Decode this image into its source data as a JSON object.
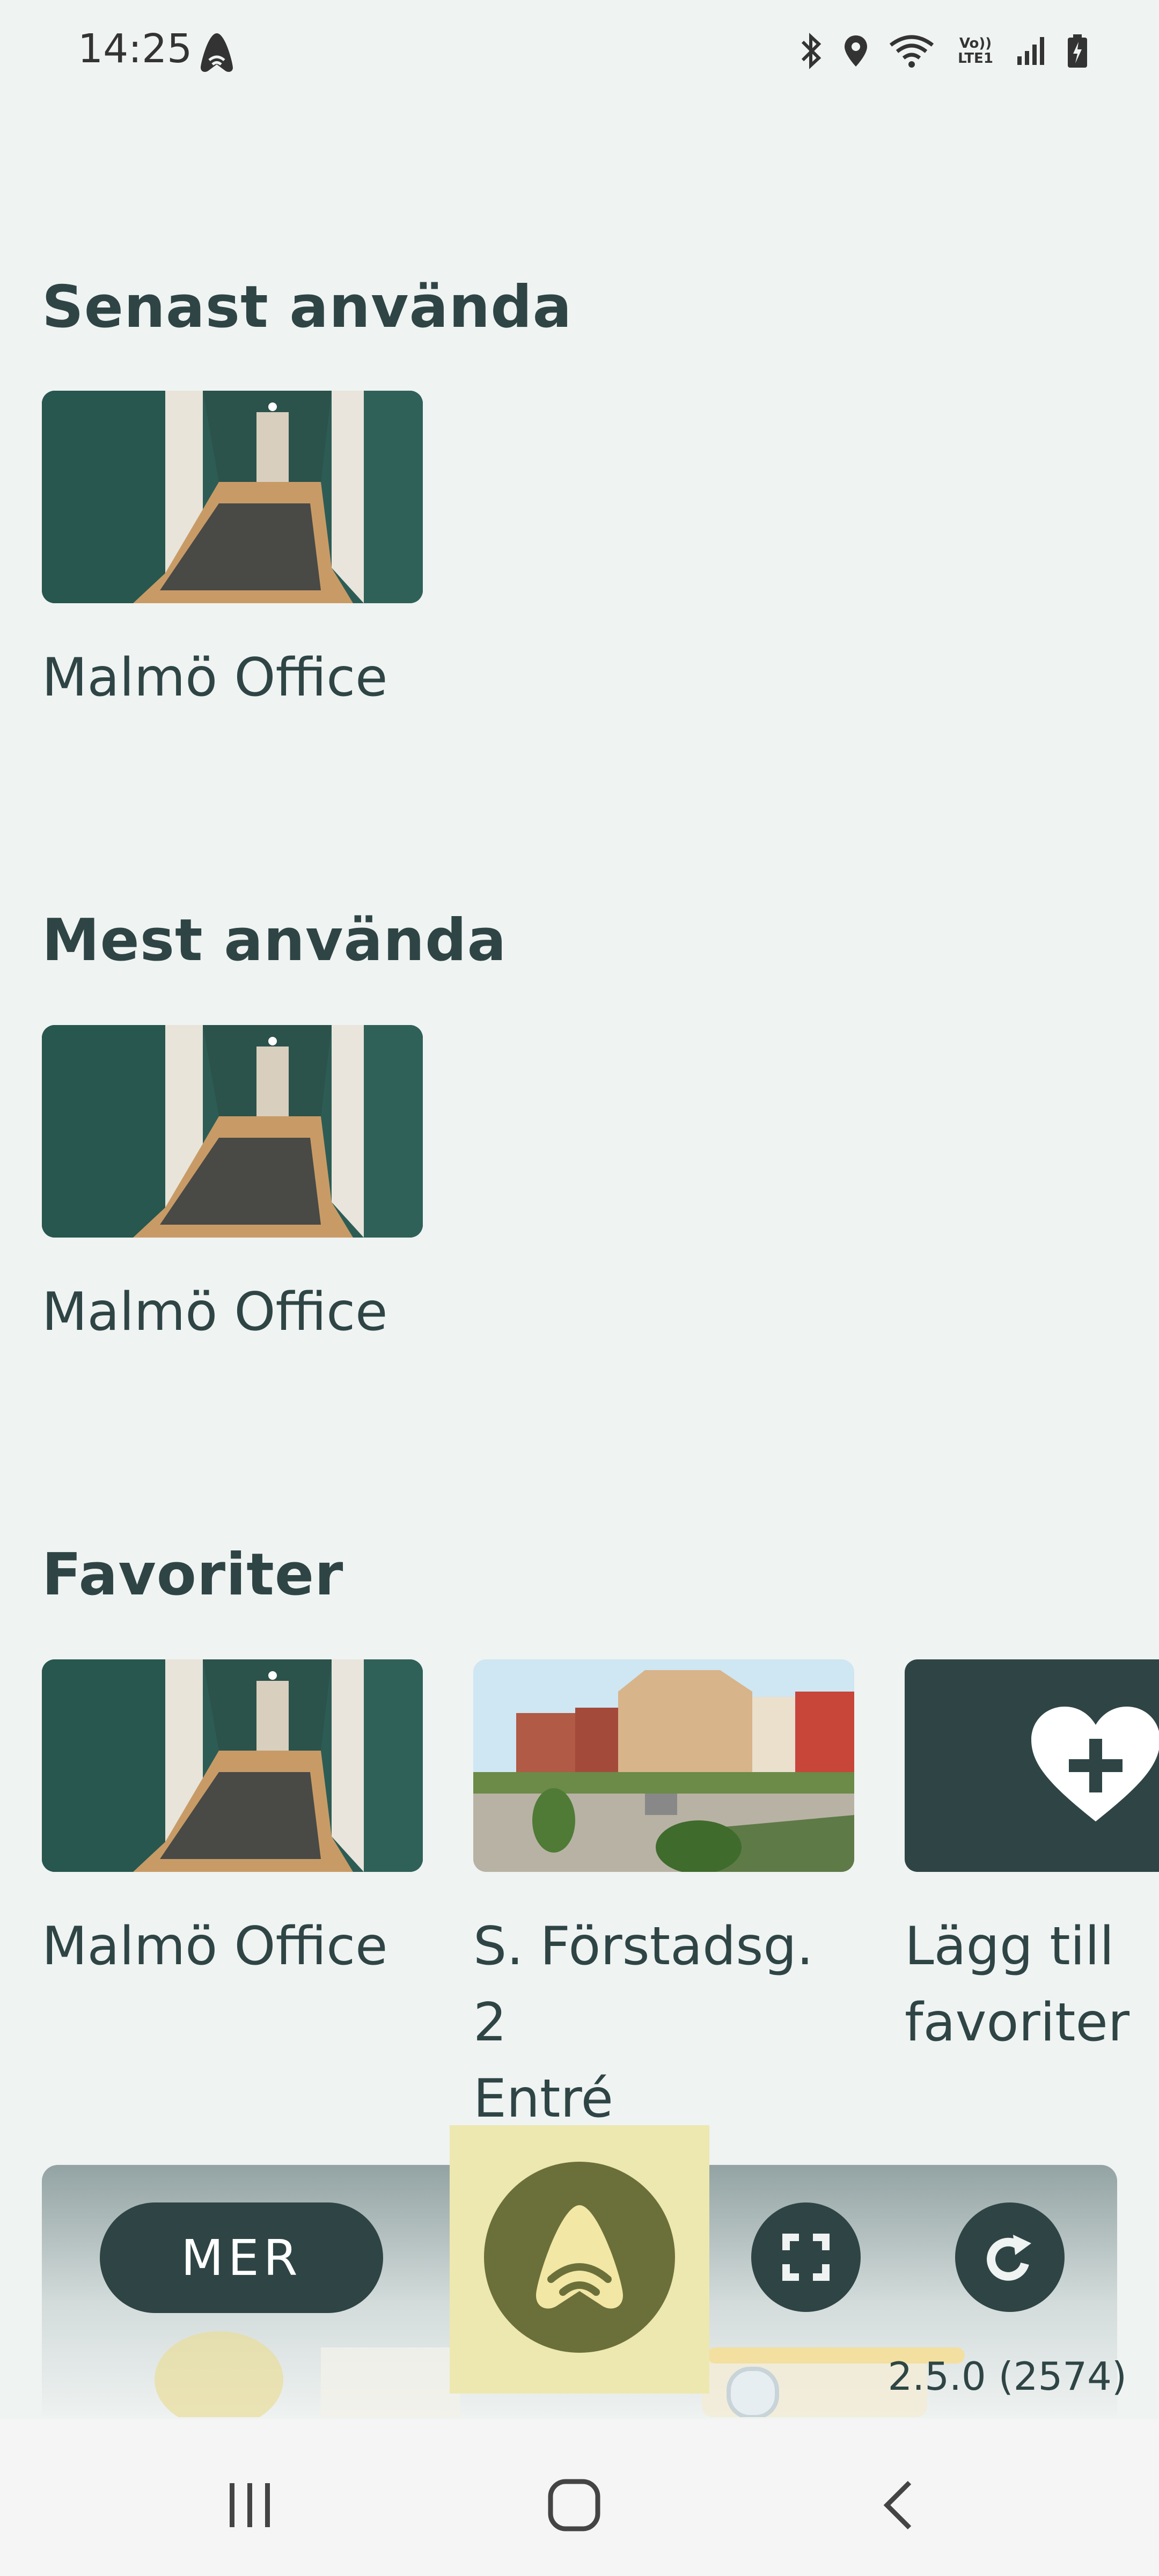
{
  "status_bar": {
    "time": "14:25",
    "network_label": "Vo)) LTE1",
    "icons": [
      "app-notification-icon",
      "bluetooth-icon",
      "location-icon",
      "wifi-icon",
      "volte-icon",
      "signal-icon",
      "battery-icon"
    ]
  },
  "sections": {
    "recent": {
      "title": "Senast använda",
      "items": [
        {
          "label": "Malmö Office",
          "image": "hallway"
        }
      ]
    },
    "most_used": {
      "title": "Mest använda",
      "items": [
        {
          "label": "Malmö Office",
          "image": "hallway"
        }
      ]
    },
    "favorites": {
      "title": "Favoriter",
      "items": [
        {
          "label": "Malmö Office",
          "image": "hallway"
        },
        {
          "label": "S. Förstadsg. 2\nEntré",
          "image": "city"
        }
      ],
      "add": {
        "label": "Lägg till\nfavoriter",
        "icon": "heart-plus-icon"
      }
    }
  },
  "bottom_panel": {
    "more_label": "MER",
    "main_button_icon": "unlock-wave-icon",
    "scan_icon": "scan-icon",
    "refresh_icon": "refresh-icon",
    "version": "2.5.0 (2574)"
  },
  "nav_bar": {
    "buttons": [
      "recents-icon",
      "home-icon",
      "back-icon"
    ]
  },
  "colors": {
    "background": "#eff3f1",
    "primary_dark": "#2f4545",
    "accent_olive": "#6b703b",
    "highlight": "#ede8b0"
  }
}
